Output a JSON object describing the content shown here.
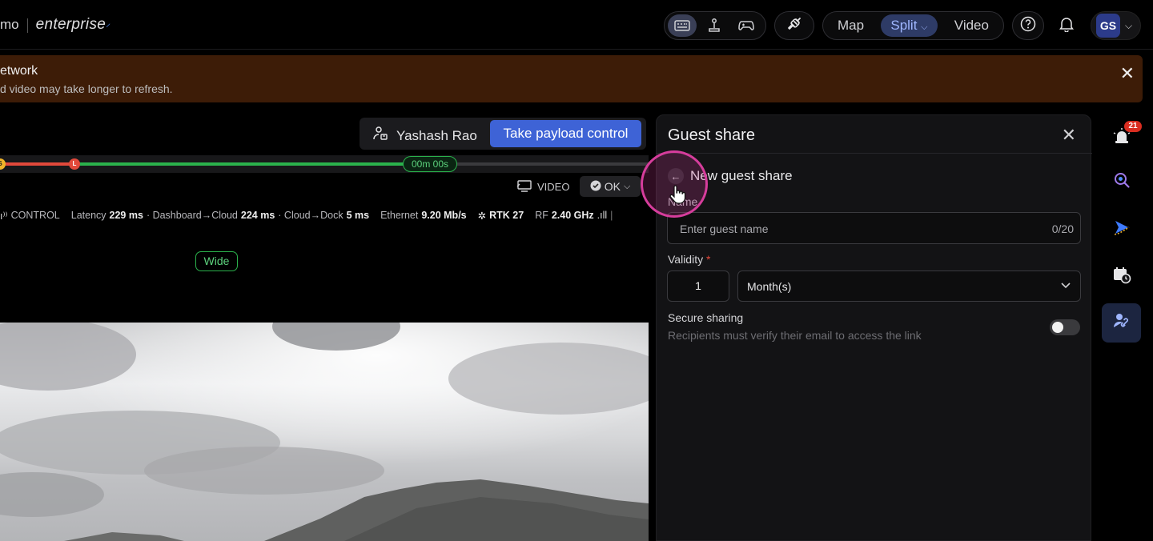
{
  "header": {
    "brand_prefix": "mo",
    "brand_name": "enterprise",
    "view_modes": [
      {
        "label": "Map",
        "active": false
      },
      {
        "label": "Split",
        "active": true
      },
      {
        "label": "Video",
        "active": false
      }
    ],
    "user_initials": "GS"
  },
  "banner": {
    "title": "etwork",
    "message": "d video may take longer to refresh."
  },
  "control_bar": {
    "user_name": "Yashash Rao",
    "take_control_label": "Take payload control"
  },
  "timeline": {
    "start_marker": "S",
    "marker_label": "L",
    "elapsed": "00m 00s",
    "red_progress": 0.115,
    "green_progress": 0.67
  },
  "video_header": {
    "video_label": "VIDEO",
    "status_label": "OK"
  },
  "stats": {
    "control_label": "CONTROL",
    "latency_label": "Latency",
    "latency_value": "229 ms",
    "dash_cloud_label": "· Dashboard→Cloud",
    "dash_cloud_value": "224 ms",
    "cloud_dock_label": "· Cloud→Dock",
    "cloud_dock_value": "5 ms",
    "ethernet_label": "Ethernet",
    "ethernet_value": "9.20 Mb/s",
    "rtk_label": "RTK 27",
    "rf_label": "RF",
    "rf_value": "2.40 GHz"
  },
  "lens_label": "Wide",
  "guest_share": {
    "title": "Guest share",
    "subtitle": "New guest share",
    "name_label": "Name",
    "name_placeholder": "Enter guest name",
    "name_counter": "0/20",
    "validity_label": "Validity",
    "required_mark": "*",
    "validity_value": "1",
    "validity_unit": "Month(s)",
    "secure_label": "Secure sharing",
    "secure_hint": "Recipients must verify their email to access the link"
  },
  "rail": {
    "alerts_badge": "21"
  },
  "colors": {
    "accent": "#3e63d6",
    "banner_bg": "#3d1c07",
    "ok_green": "#2bb24c",
    "cursor_ring": "#d63d9c"
  }
}
